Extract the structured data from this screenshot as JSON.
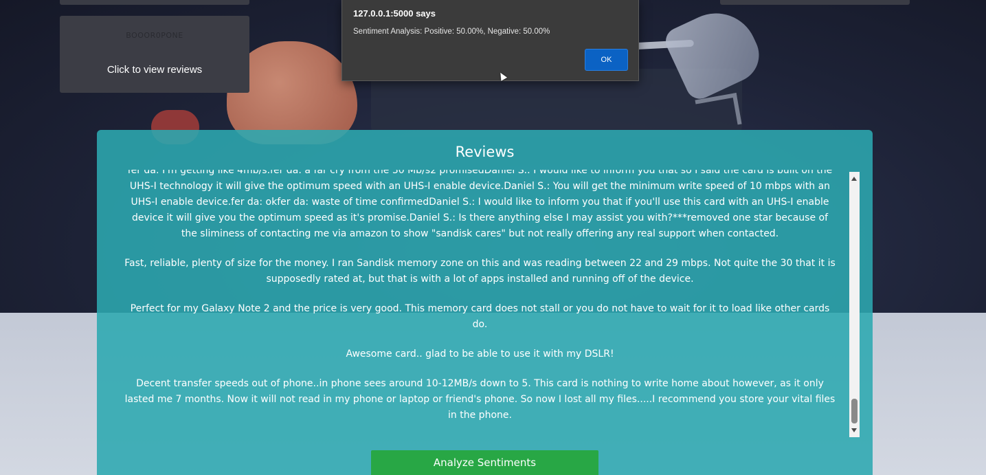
{
  "product_card": {
    "name": "BOOOR0PONE",
    "link_label": "Click to view reviews"
  },
  "alert": {
    "title": "127.0.0.1:5000 says",
    "message": "Sentiment Analysis: Positive: 50.00%, Negative: 50.00%",
    "ok_label": "OK"
  },
  "reviews": {
    "title": "Reviews",
    "items": [
      "fer da: I'm getting like 4mb/s.fer da: a far cry from the 30 Mb/s2 promisedDaniel S.: I would like to inform you that so I said the card is built on the UHS-I technology it will give the optimum speed with an UHS-I enable device.Daniel S.: You will get the minimum write speed of 10 mbps with an UHS-I enable device.fer da: okfer da: waste of time confirmedDaniel S.: I would like to inform you that if you'll use this card with an UHS-I enable device it will give you the optimum speed as it's promise.Daniel S.: Is there anything else I may assist you with?***removed one star because of the sliminess of contacting me via amazon to show \"sandisk cares\" but not really offering any real support when contacted.",
      "Fast, reliable, plenty of size for the money. I ran Sandisk memory zone on this and was reading between 22 and 29 mbps. Not quite the 30 that it is supposedly rated at, but that is with a lot of apps installed and running off of the device.",
      "Perfect for my Galaxy Note 2 and the price is very good. This memory card does not stall or you do not have to wait for it to load like other cards do.",
      "Awesome card.. glad to be able to use it with my DSLR!",
      "Decent transfer speeds out of phone..in phone sees around 10-12MB/s down to 5. This card is nothing to write home about however, as it only lasted me 7 months. Now it will not read in my phone or laptop or friend's phone. So now I lost all my files.....I recommend you store your vital files in the phone."
    ],
    "analyze_label": "Analyze Sentiments"
  },
  "colors": {
    "panel": "#2ca8b0",
    "analyze_button": "#28a745",
    "ok_button": "#0b62c4"
  }
}
